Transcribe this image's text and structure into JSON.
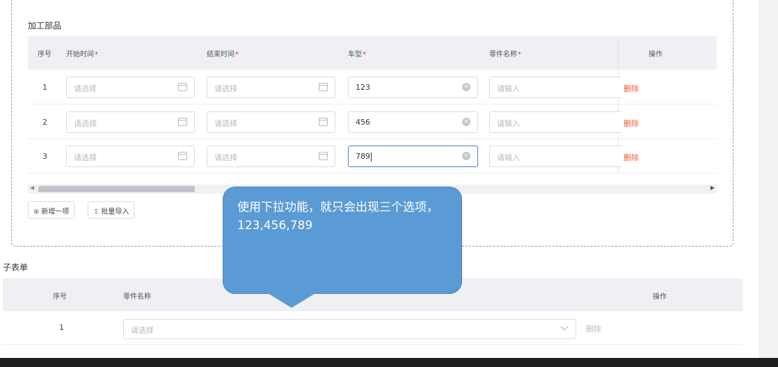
{
  "form": {
    "section_title": "加工部品",
    "columns": {
      "index": "序号",
      "start_time": "开始时间",
      "end_time": "结束时间",
      "car_model": "车型",
      "part_name": "零件名称",
      "actions": "操作"
    },
    "required_mark": "*",
    "rows": [
      {
        "index": "1",
        "start_placeholder": "请选择",
        "end_placeholder": "请选择",
        "car_model": "123",
        "part_placeholder": "请输入",
        "delete": "删除"
      },
      {
        "index": "2",
        "start_placeholder": "请选择",
        "end_placeholder": "请选择",
        "car_model": "456",
        "part_placeholder": "请输入",
        "delete": "删除"
      },
      {
        "index": "3",
        "start_placeholder": "请选择",
        "end_placeholder": "请选择",
        "car_model": "789",
        "part_placeholder": "请输入",
        "delete": "删除"
      }
    ],
    "add_button": "新增一项",
    "import_button": "批量导入"
  },
  "subtable": {
    "title": "子表单",
    "columns": {
      "index": "序号",
      "part_name": "零件名称",
      "actions": "操作"
    },
    "rows": [
      {
        "index": "1",
        "part_placeholder": "请选择",
        "delete": "删除"
      }
    ]
  },
  "callout": {
    "text": "使用下拉功能，就只会出现三个选项，123,456,789"
  },
  "colors": {
    "callout_fill": "#5b9bd5",
    "delete_link": "#f05a3a",
    "required": "#ee3333",
    "focus_border": "#4a7ccf"
  }
}
